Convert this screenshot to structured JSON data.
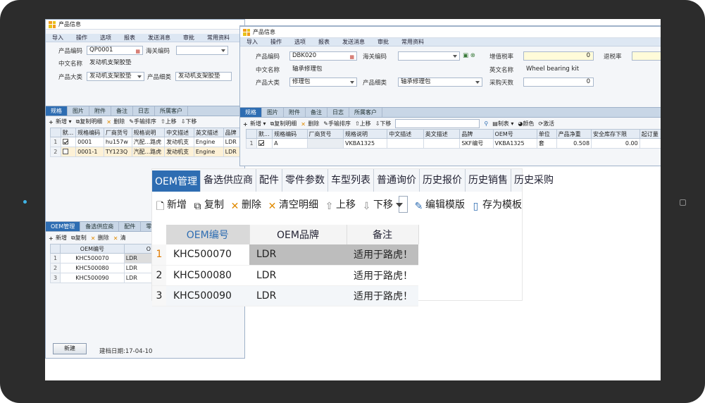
{
  "left_window": {
    "title": "产品信息",
    "menu": [
      "导入",
      "操作",
      "选项",
      "报表",
      "发送消息",
      "审批",
      "常用资料"
    ],
    "product_code_label": "产品编码",
    "product_code": "QP0001",
    "customs_code_label": "海关编码",
    "chinese_name_label": "中文名称",
    "chinese_name": "发动机支架胶垫",
    "category_label": "产品大类",
    "category": "发动机支架胶垫",
    "subcategory_label": "产品细类",
    "subcategory": "发动机支架胶垫",
    "tabs": [
      "规格",
      "图片",
      "附件",
      "备注",
      "日志",
      "所属客户"
    ],
    "toolbar": [
      "新增",
      "复制明细",
      "删除",
      "手输排序",
      "上移",
      "下移"
    ],
    "spec_headers": [
      "默...",
      "规格编码",
      "厂商货号",
      "规格说明",
      "中文描述",
      "英文描述",
      "品牌"
    ],
    "spec_rows": [
      {
        "n": "1",
        "code": "0001",
        "vendor": "hu157w",
        "desc": "汽配...路虎",
        "cn": "发动机支",
        "en": "Engine",
        "brand": "LDR"
      },
      {
        "n": "2",
        "code": "0001-1",
        "vendor": "TY123Q",
        "desc": "汽配...路虎",
        "cn": "发动机支",
        "en": "Engine",
        "brand": "LDR"
      }
    ],
    "bottom_tabs": [
      "OEM管理",
      "备选供应商",
      "配件",
      "零"
    ],
    "bottom_toolbar": [
      "新增",
      "复制",
      "删除",
      "清"
    ],
    "oem_header": "OEM编号",
    "oem_header2": "O",
    "oem_rows": [
      {
        "n": "1",
        "code": "KHC500070",
        "brand": "LDR"
      },
      {
        "n": "2",
        "code": "KHC500080",
        "brand": "LDR"
      },
      {
        "n": "3",
        "code": "KHC500090",
        "brand": "LDR"
      }
    ],
    "new_button": "新建",
    "created_date": "建档日期:17-04-10"
  },
  "right_window": {
    "title": "产品信息",
    "menu": [
      "导入",
      "操作",
      "选项",
      "报表",
      "发送消息",
      "审批",
      "常用资料"
    ],
    "product_code_label": "产品编码",
    "product_code": "DBK020",
    "customs_code_label": "海关编码",
    "vat_label": "增值税率",
    "vat": "0",
    "rebate_label": "退税率",
    "chinese_name_label": "中文名称",
    "chinese_name": "轴承修理包",
    "english_name_label": "英文名称",
    "english_name": "Wheel bearing kit",
    "category_label": "产品大类",
    "category": "修理包",
    "subcategory_label": "产品细类",
    "subcategory": "轴承修理包",
    "purchase_days_label": "采购天数",
    "purchase_days": "0",
    "tabs": [
      "规格",
      "图片",
      "附件",
      "备注",
      "日志",
      "所属客户"
    ],
    "toolbar": [
      "新增",
      "复制明细",
      "删除",
      "手输排序",
      "上移",
      "下移",
      "制表",
      "颜色",
      "激活"
    ],
    "spec_headers": [
      "默...",
      "规格编码",
      "厂商货号",
      "规格说明",
      "中文描述",
      "英文描述",
      "品牌",
      "OEM号",
      "单位",
      "产品净重",
      "安全库存下限",
      "起订量"
    ],
    "spec_row": {
      "n": "1",
      "code": "A",
      "desc": "VKBA1325",
      "brand": "SKF编号",
      "oem": "VKBA1325",
      "unit": "套",
      "weight": "0.508",
      "safety": "0.00"
    }
  },
  "zoom_panel": {
    "tabs": [
      "OEM管理",
      "备选供应商",
      "配件",
      "零件参数",
      "车型列表",
      "普通询价",
      "历史报价",
      "历史销售",
      "历史采购"
    ],
    "toolbar": [
      "新增",
      "复制",
      "删除",
      "清空明细",
      "上移",
      "下移",
      "编辑模版",
      "存为模板"
    ],
    "headers": [
      "OEM编号",
      "OEM品牌",
      "备注"
    ],
    "rows": [
      {
        "n": "1",
        "code": "KHC500070",
        "brand": "LDR",
        "note": "适用于路虎！"
      },
      {
        "n": "2",
        "code": "KHC500080",
        "brand": "LDR",
        "note": "适用于路虎！"
      },
      {
        "n": "3",
        "code": "KHC500090",
        "brand": "LDR",
        "note": "适用于路虎！"
      }
    ]
  }
}
